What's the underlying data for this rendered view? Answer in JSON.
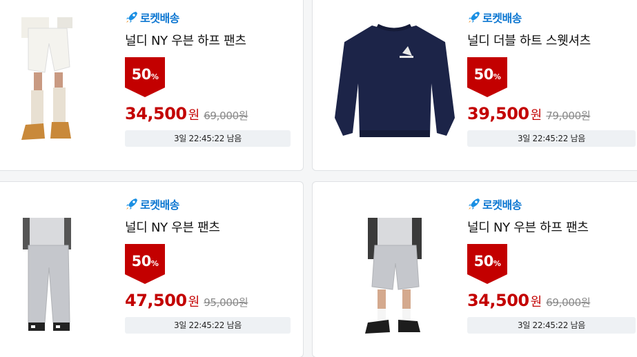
{
  "products": [
    {
      "delivery_label": "로켓배송",
      "title": "널디 NY 우븐 하프 팬츠",
      "discount_number": "50",
      "discount_unit": "%",
      "sale_price": "34,500",
      "currency": "원",
      "original_price": "69,000원",
      "timer": "3일 22:45:22 남음",
      "image": "white-shorts-model"
    },
    {
      "delivery_label": "로켓배송",
      "title": "널디 더블 하트 스웻셔츠",
      "discount_number": "50",
      "discount_unit": "%",
      "sale_price": "39,500",
      "currency": "원",
      "original_price": "79,000원",
      "timer": "3일 22:45:22 남음",
      "image": "navy-sweatshirt"
    },
    {
      "delivery_label": "로켓배송",
      "title": "널디 NY 우븐 팬츠",
      "discount_number": "50",
      "discount_unit": "%",
      "sale_price": "47,500",
      "currency": "원",
      "original_price": "95,000원",
      "timer": "3일 22:45:22 남음",
      "image": "grey-pants-model"
    },
    {
      "delivery_label": "로켓배송",
      "title": "널디 NY 우븐 하프 팬츠",
      "discount_number": "50",
      "discount_unit": "%",
      "sale_price": "34,500",
      "currency": "원",
      "original_price": "69,000원",
      "timer": "3일 22:45:22 남음",
      "image": "grey-shorts-model"
    }
  ],
  "colors": {
    "rocket_blue": "#0b76d1",
    "badge_red": "#c30000",
    "price_red": "#c30000",
    "timer_bg": "#eef1f4"
  },
  "icons": {
    "delivery": "rocket-icon",
    "badge": "discount-badge-icon"
  }
}
